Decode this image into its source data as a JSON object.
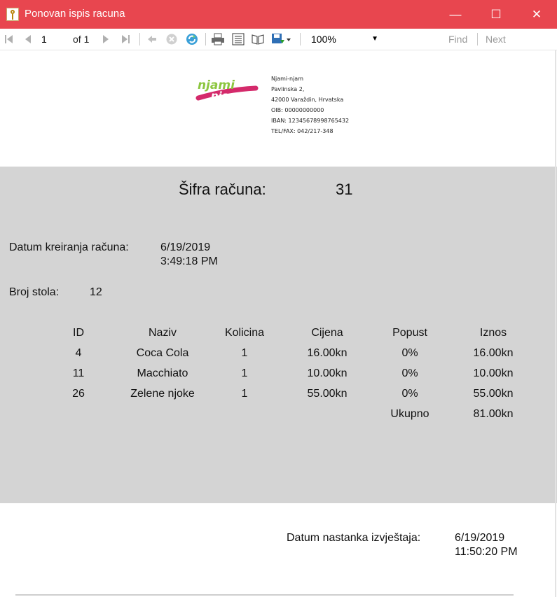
{
  "window": {
    "title": "Ponovan ispis racuna",
    "minimize_glyph": "—",
    "maximize_glyph": "☐",
    "close_glyph": "✕",
    "accent": "#e8464f"
  },
  "toolbar": {
    "page_current": "1",
    "page_of": "of 1",
    "zoom": "100%",
    "find_label": "Find",
    "next_label": "Next"
  },
  "company": {
    "logo_text": "njami njam",
    "name": "Njami-njam",
    "address": "Pavlinska 2,",
    "city": "42000  Varaždin, Hrvatska",
    "oib": "OIB: 00000000000",
    "iban": "IBAN: 12345678998765432",
    "tel": "TEL/FAX: 042/217-348"
  },
  "receipt": {
    "code_label": "Šifra računa:",
    "code_value": "31",
    "created_label": "Datum kreiranja računa:",
    "created_date": "6/19/2019",
    "created_time": "3:49:18 PM",
    "table_label": "Broj stola:",
    "table_value": "12",
    "columns": [
      "ID",
      "Naziv",
      "Kolicina",
      "Cijena",
      "Popust",
      "Iznos"
    ],
    "items": [
      [
        "4",
        "Coca Cola",
        "1",
        "16.00kn",
        "0%",
        "16.00kn"
      ],
      [
        "11",
        "Macchiato",
        "1",
        "10.00kn",
        "0%",
        "10.00kn"
      ],
      [
        "26",
        "Zelene njoke",
        "1",
        "55.00kn",
        "0%",
        "55.00kn"
      ]
    ],
    "total_label": "Ukupno",
    "total_value": "81.00kn"
  },
  "footer": {
    "report_label": "Datum nastanka izvještaja:",
    "report_date": "6/19/2019",
    "report_time": "11:50:20 PM"
  }
}
